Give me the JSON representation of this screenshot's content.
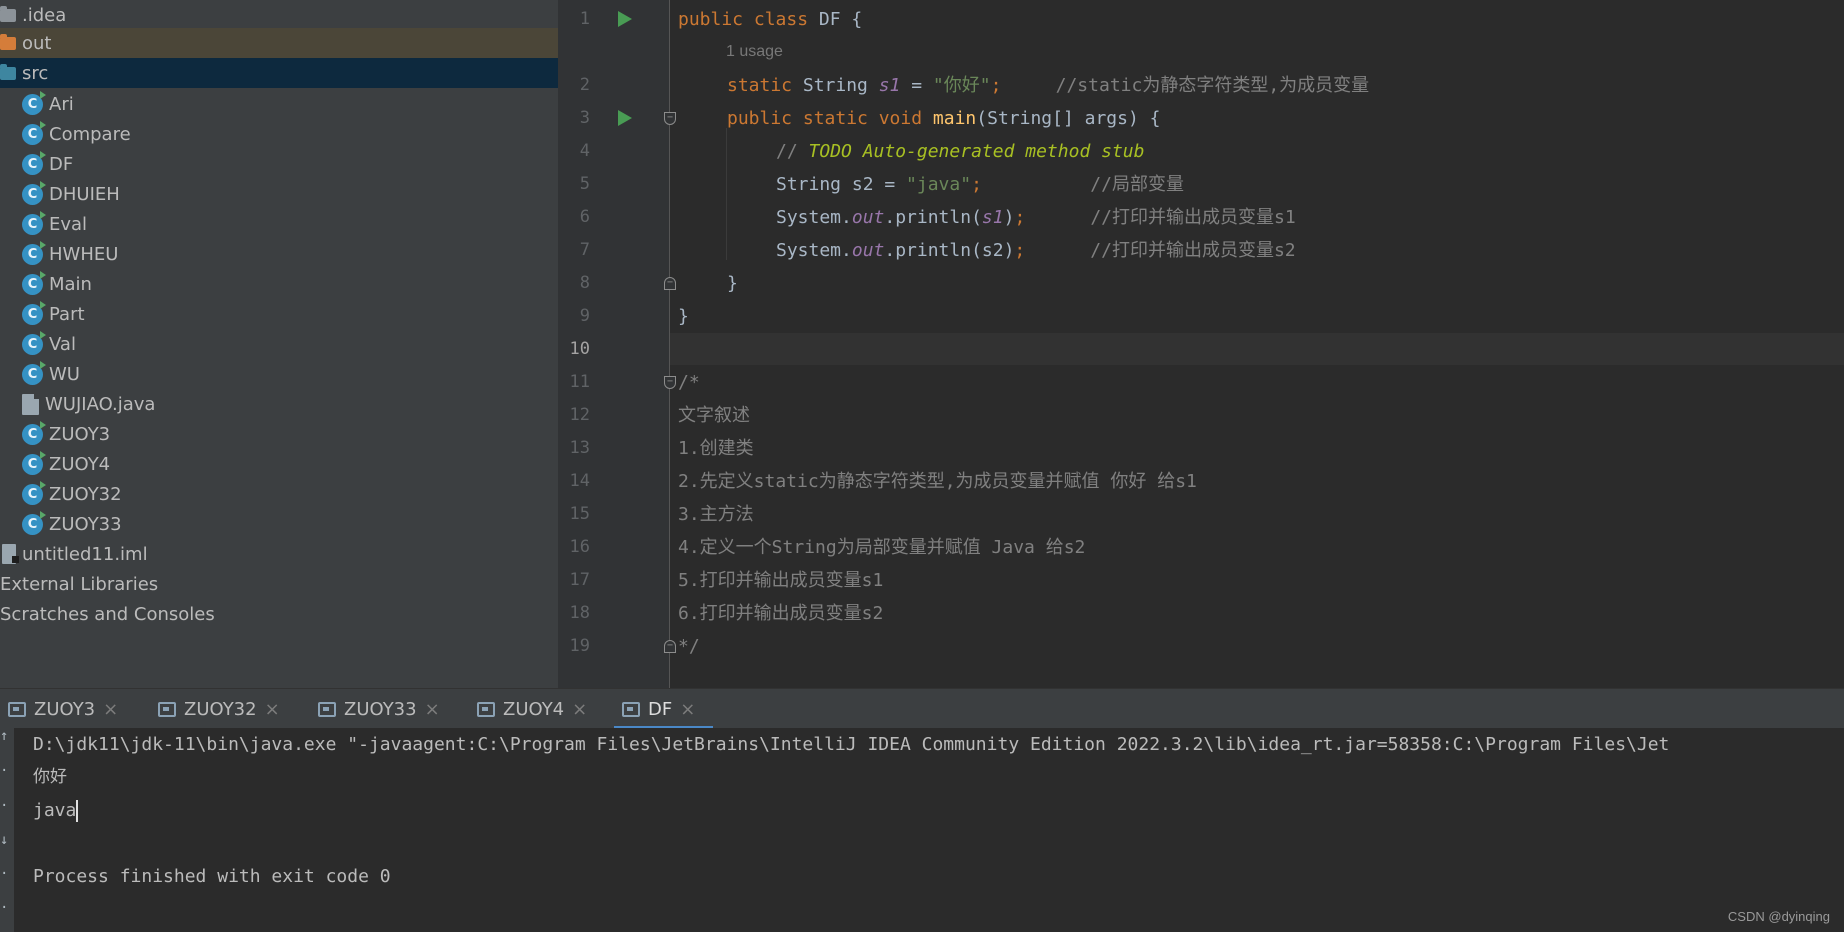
{
  "project_tree": {
    "items": [
      {
        "label": ".idea",
        "icon": "folder-grey-icon"
      },
      {
        "label": "out",
        "icon": "folder-orange-icon"
      },
      {
        "label": "src",
        "icon": "folder-blue-icon"
      },
      {
        "label": "Ari",
        "icon": "java-class-icon"
      },
      {
        "label": "Compare",
        "icon": "java-class-icon"
      },
      {
        "label": "DF",
        "icon": "java-class-icon"
      },
      {
        "label": "DHUIEH",
        "icon": "java-class-icon"
      },
      {
        "label": "Eval",
        "icon": "java-class-icon"
      },
      {
        "label": "HWHEU",
        "icon": "java-class-icon"
      },
      {
        "label": "Main",
        "icon": "java-class-icon"
      },
      {
        "label": "Part",
        "icon": "java-class-icon"
      },
      {
        "label": "Val",
        "icon": "java-class-icon"
      },
      {
        "label": "WU",
        "icon": "java-class-icon"
      },
      {
        "label": "WUJIAO.java",
        "icon": "java-file-icon"
      },
      {
        "label": "ZUOY3",
        "icon": "java-class-icon"
      },
      {
        "label": "ZUOY4",
        "icon": "java-class-icon"
      },
      {
        "label": "ZUOY32",
        "icon": "java-class-icon"
      },
      {
        "label": "ZUOY33",
        "icon": "java-class-icon"
      },
      {
        "label": "untitled11.iml",
        "icon": "iml-file-icon"
      },
      {
        "label": "External Libraries",
        "icon": ""
      },
      {
        "label": "Scratches and Consoles",
        "icon": ""
      }
    ],
    "class_icon_letter": "C"
  },
  "editor": {
    "line_numbers": [
      "1",
      "2",
      "3",
      "4",
      "5",
      "6",
      "7",
      "8",
      "9",
      "10",
      "11",
      "12",
      "13",
      "14",
      "15",
      "16",
      "17",
      "18",
      "19"
    ],
    "usage_hint": "1 usage",
    "code": {
      "l1": {
        "kw": "public class ",
        "name": "DF",
        "rest": " {"
      },
      "l2": {
        "kw": "static ",
        "type": "String ",
        "field": "s1",
        "eq": " = ",
        "str": "\"你好\"",
        "semi": ";",
        "cmt": "     //static为静态字符类型,为成员变量"
      },
      "l3": {
        "kw": "public static void ",
        "fn": "main",
        "rest": "(String[] args) {"
      },
      "l4": {
        "cmt": "// ",
        "todo": "TODO Auto-generated method stub"
      },
      "l5": {
        "type": "String s2 = ",
        "str": "\"java\"",
        "semi": ";",
        "cmt": "          //局部变量"
      },
      "l6": {
        "pre": "System.",
        "field": "out",
        "call": ".println(",
        "arg": "s1",
        "close": ")",
        "semi": ";",
        "cmt": "      //打印并输出成员变量s1"
      },
      "l7": {
        "pre": "System.",
        "field": "out",
        "call": ".println(s2)",
        "semi": ";",
        "cmt": "      //打印并输出成员变量s2"
      },
      "l8": "}",
      "l9": "}",
      "l11": "/*",
      "l12": "文字叙述",
      "l13": "1.创建类",
      "l14": "2.先定义static为静态字符类型,为成员变量并赋值 你好 给s1",
      "l15": "3.主方法",
      "l16": "4.定义一个String为局部变量并赋值 Java 给s2",
      "l17": "5.打印并输出成员变量s1",
      "l18": "6.打印并输出成员变量s2",
      "l19": "*/"
    }
  },
  "run_tabs": [
    {
      "label": "ZUOY3"
    },
    {
      "label": "ZUOY32"
    },
    {
      "label": "ZUOY33"
    },
    {
      "label": "ZUOY4"
    },
    {
      "label": "DF",
      "active": true
    }
  ],
  "tab_close_glyph": "×",
  "console": {
    "command": "D:\\jdk11\\jdk-11\\bin\\java.exe \"-javaagent:C:\\Program Files\\JetBrains\\IntelliJ IDEA Community Edition 2022.3.2\\lib\\idea_rt.jar=58358:C:\\Program Files\\Jet",
    "out1": "你好",
    "out2": "java",
    "exit": "Process finished with exit code 0"
  },
  "watermark": "CSDN @dyinqing",
  "colors": {
    "tree_bg": "#3c3f41",
    "editor_bg": "#2b2b2b",
    "keyword": "#cc7832",
    "string": "#6a8759",
    "field": "#9876aa",
    "method": "#ffc66d",
    "comment": "#808080",
    "todo": "#a8c023",
    "run_green": "#499c54",
    "selection_src": "#0d293e",
    "active_tab_underline": "#4a88c7"
  }
}
